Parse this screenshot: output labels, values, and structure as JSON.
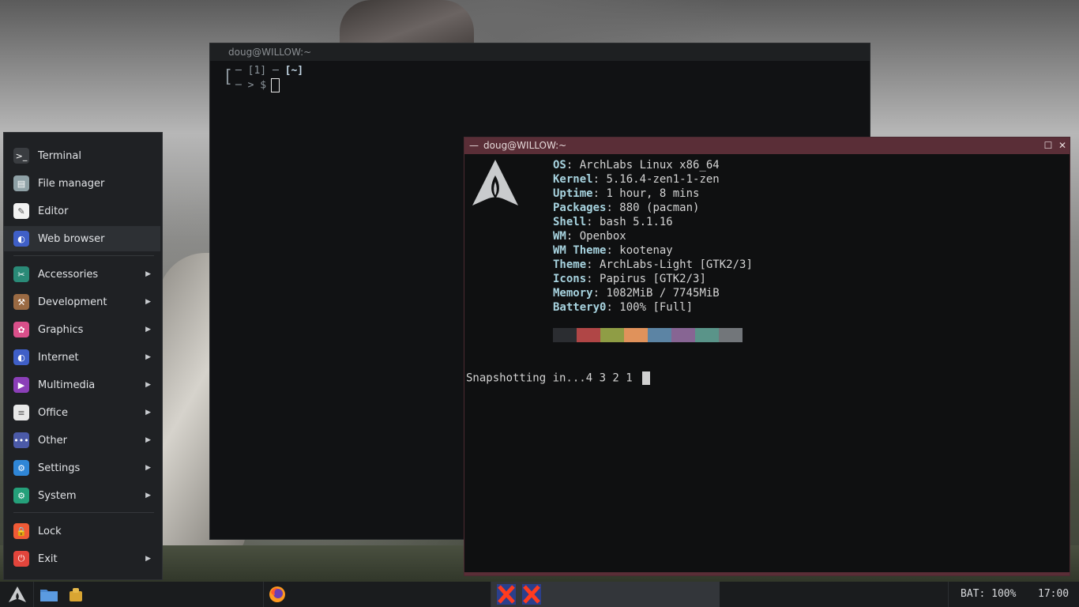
{
  "terminal_back": {
    "title": "doug@WILLOW:~",
    "prompt_line1_prefix": "─ [1] ─ ",
    "prompt_dir": "[~]",
    "prompt_line2": "─ > $"
  },
  "terminal_front": {
    "title": "doug@WILLOW:~",
    "title_dash": "—",
    "info": [
      {
        "key": "OS",
        "value": "ArchLabs Linux x86_64"
      },
      {
        "key": "Kernel",
        "value": "5.16.4-zen1-1-zen"
      },
      {
        "key": "Uptime",
        "value": "1 hour, 8 mins"
      },
      {
        "key": "Packages",
        "value": "880 (pacman)"
      },
      {
        "key": "Shell",
        "value": "bash 5.1.16"
      },
      {
        "key": "WM",
        "value": "Openbox"
      },
      {
        "key": "WM Theme",
        "value": "kootenay"
      },
      {
        "key": "Theme",
        "value": "ArchLabs-Light [GTK2/3]"
      },
      {
        "key": "Icons",
        "value": "Papirus [GTK2/3]"
      },
      {
        "key": "Memory",
        "value": "1082MiB / 7745MiB"
      },
      {
        "key": "Battery0",
        "value": "100% [Full]"
      }
    ],
    "palette": [
      "#2b2d31",
      "#b04646",
      "#8f9d45",
      "#e0925b",
      "#5c84a4",
      "#876593",
      "#5a9489",
      "#72767a"
    ],
    "snapshot_text": "Snapshotting in...4 3 2 1"
  },
  "menu": {
    "items": [
      {
        "label": "Terminal",
        "icon": "terminal-icon",
        "color": "#3a3d41",
        "glyph": ">_"
      },
      {
        "label": "File manager",
        "icon": "file-manager-icon",
        "color": "#8fa1a6",
        "glyph": "▤"
      },
      {
        "label": "Editor",
        "icon": "editor-icon",
        "color": "#f2f2f2",
        "glyph": "✎"
      },
      {
        "label": "Web browser",
        "icon": "web-browser-icon",
        "color": "#3f5fc7",
        "glyph": "◐"
      },
      {
        "label": "Accessories",
        "icon": "accessories-icon",
        "color": "#2a8a77",
        "glyph": "✂"
      },
      {
        "label": "Development",
        "icon": "development-icon",
        "color": "#9a6a43",
        "glyph": "⚒"
      },
      {
        "label": "Graphics",
        "icon": "graphics-icon",
        "color": "#d94f8a",
        "glyph": "✿"
      },
      {
        "label": "Internet",
        "icon": "internet-icon",
        "color": "#3f5fc7",
        "glyph": "◐"
      },
      {
        "label": "Multimedia",
        "icon": "multimedia-icon",
        "color": "#8b3fb8",
        "glyph": "▶"
      },
      {
        "label": "Office",
        "icon": "office-icon",
        "color": "#e8e8e8",
        "glyph": "≡"
      },
      {
        "label": "Other",
        "icon": "other-icon",
        "color": "#4b5aa8",
        "glyph": "•••"
      },
      {
        "label": "Settings",
        "icon": "settings-icon",
        "color": "#2f86d6",
        "glyph": "⚙"
      },
      {
        "label": "System",
        "icon": "system-icon",
        "color": "#25a07a",
        "glyph": "⚙"
      },
      {
        "label": "Lock",
        "icon": "lock-icon",
        "color": "#f05a36",
        "glyph": "🔒"
      },
      {
        "label": "Exit",
        "icon": "exit-icon",
        "color": "#e2453c",
        "glyph": "⏻"
      }
    ],
    "submenu_arrow": "▶"
  },
  "taskbar": {
    "battery": "BAT: 100%",
    "clock": "17:00"
  }
}
